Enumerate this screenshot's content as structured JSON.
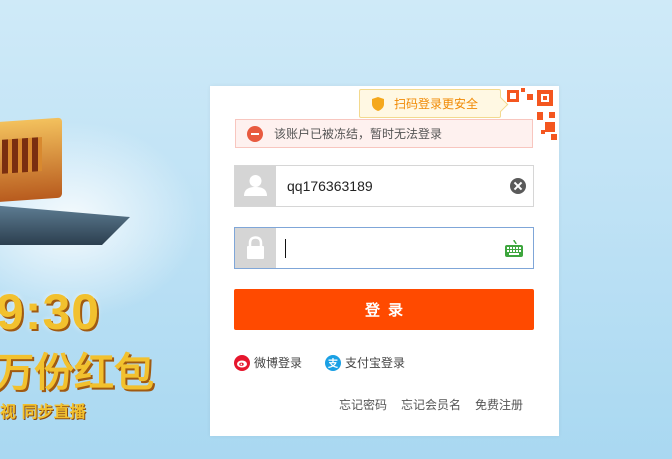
{
  "background": {
    "time_text": "9:30",
    "headline": "万份红包",
    "live_text": "视 同步直播"
  },
  "qr_tip": {
    "text": "扫码登录更安全",
    "icon": "shield-icon"
  },
  "alert": {
    "text": "该账户已被冻结，暂时无法登录",
    "icon": "error-minus-icon"
  },
  "username": {
    "value": "qq176363189",
    "icon": "user-icon",
    "clear_icon": "clear-icon"
  },
  "password": {
    "value": "",
    "icon": "lock-icon",
    "keyboard_icon": "keyboard-icon"
  },
  "login_button": {
    "label": "登录"
  },
  "alt_login": {
    "weibo": {
      "label": "微博登录",
      "icon": "weibo-icon"
    },
    "alipay": {
      "label": "支付宝登录",
      "icon": "alipay-icon",
      "glyph": "支"
    }
  },
  "footer": {
    "forgot_password": "忘记密码",
    "forgot_username": "忘记会员名",
    "register": "免费注册"
  },
  "colors": {
    "primary": "#ff4a00",
    "qr": "#f4561f",
    "alert_bg": "#fef1ef"
  }
}
